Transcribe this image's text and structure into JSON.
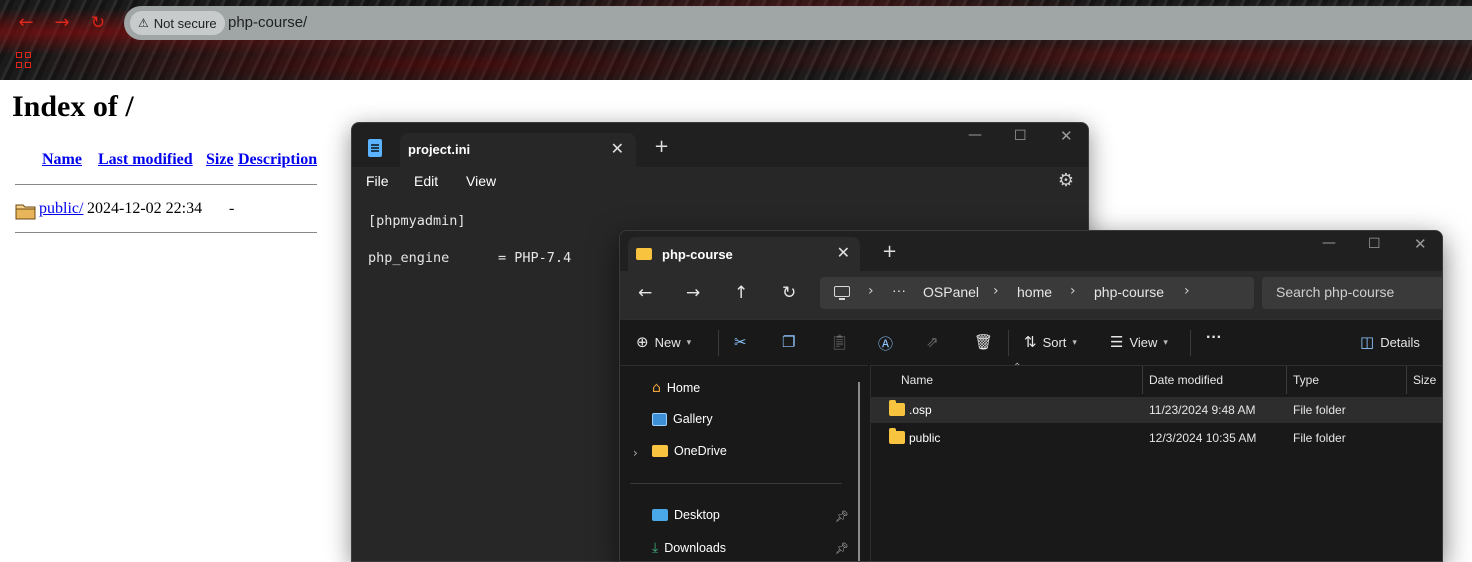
{
  "browser": {
    "address_security": "Not secure",
    "url": "php-course/"
  },
  "index_page": {
    "title": "Index of /",
    "columns": [
      "Name",
      "Last modified",
      "Size",
      "Description"
    ],
    "rows": [
      {
        "name": "public/",
        "modified": "2024-12-02 22:34",
        "size": "-",
        "description": ""
      }
    ]
  },
  "notepad": {
    "tab_title": "project.ini",
    "menu": [
      "File",
      "Edit",
      "View"
    ],
    "lines": [
      "[phpmyadmin]",
      "php_engine      = PHP-7.4"
    ]
  },
  "explorer": {
    "tab_title": "php-course",
    "breadcrumb": [
      "OSPanel",
      "home",
      "php-course"
    ],
    "search_placeholder": "Search php-course",
    "toolbar": {
      "new_label": "New",
      "sort_label": "Sort",
      "view_label": "View",
      "more_label": "···",
      "details_label": "Details"
    },
    "sidebar": [
      {
        "label": "Home",
        "icon": "home-icon"
      },
      {
        "label": "Gallery",
        "icon": "gallery-icon"
      },
      {
        "label": "OneDrive",
        "icon": "folder-icon"
      },
      {
        "label": "Desktop",
        "icon": "desktop-icon"
      },
      {
        "label": "Downloads",
        "icon": "downloads-icon"
      }
    ],
    "columns": [
      "Name",
      "Date modified",
      "Type",
      "Size"
    ],
    "files": [
      {
        "name": ".osp",
        "date": "11/23/2024 9:48 AM",
        "type": "File folder"
      },
      {
        "name": "public",
        "date": "12/3/2024 10:35 AM",
        "type": "File folder"
      }
    ]
  },
  "colors": {
    "browser_accent": "#e0251b",
    "folder": "#f8c33f",
    "link": "#0000ee"
  }
}
